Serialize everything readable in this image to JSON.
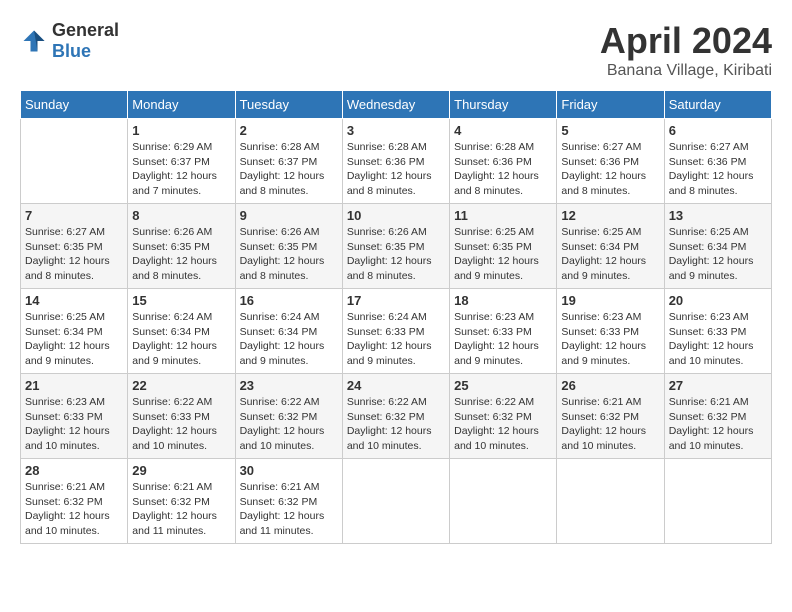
{
  "header": {
    "logo_general": "General",
    "logo_blue": "Blue",
    "month_year": "April 2024",
    "location": "Banana Village, Kiribati"
  },
  "weekdays": [
    "Sunday",
    "Monday",
    "Tuesday",
    "Wednesday",
    "Thursday",
    "Friday",
    "Saturday"
  ],
  "weeks": [
    [
      {
        "day": "",
        "info": ""
      },
      {
        "day": "1",
        "info": "Sunrise: 6:29 AM\nSunset: 6:37 PM\nDaylight: 12 hours\nand 7 minutes."
      },
      {
        "day": "2",
        "info": "Sunrise: 6:28 AM\nSunset: 6:37 PM\nDaylight: 12 hours\nand 8 minutes."
      },
      {
        "day": "3",
        "info": "Sunrise: 6:28 AM\nSunset: 6:36 PM\nDaylight: 12 hours\nand 8 minutes."
      },
      {
        "day": "4",
        "info": "Sunrise: 6:28 AM\nSunset: 6:36 PM\nDaylight: 12 hours\nand 8 minutes."
      },
      {
        "day": "5",
        "info": "Sunrise: 6:27 AM\nSunset: 6:36 PM\nDaylight: 12 hours\nand 8 minutes."
      },
      {
        "day": "6",
        "info": "Sunrise: 6:27 AM\nSunset: 6:36 PM\nDaylight: 12 hours\nand 8 minutes."
      }
    ],
    [
      {
        "day": "7",
        "info": "Sunrise: 6:27 AM\nSunset: 6:35 PM\nDaylight: 12 hours\nand 8 minutes."
      },
      {
        "day": "8",
        "info": "Sunrise: 6:26 AM\nSunset: 6:35 PM\nDaylight: 12 hours\nand 8 minutes."
      },
      {
        "day": "9",
        "info": "Sunrise: 6:26 AM\nSunset: 6:35 PM\nDaylight: 12 hours\nand 8 minutes."
      },
      {
        "day": "10",
        "info": "Sunrise: 6:26 AM\nSunset: 6:35 PM\nDaylight: 12 hours\nand 8 minutes."
      },
      {
        "day": "11",
        "info": "Sunrise: 6:25 AM\nSunset: 6:35 PM\nDaylight: 12 hours\nand 9 minutes."
      },
      {
        "day": "12",
        "info": "Sunrise: 6:25 AM\nSunset: 6:34 PM\nDaylight: 12 hours\nand 9 minutes."
      },
      {
        "day": "13",
        "info": "Sunrise: 6:25 AM\nSunset: 6:34 PM\nDaylight: 12 hours\nand 9 minutes."
      }
    ],
    [
      {
        "day": "14",
        "info": "Sunrise: 6:25 AM\nSunset: 6:34 PM\nDaylight: 12 hours\nand 9 minutes."
      },
      {
        "day": "15",
        "info": "Sunrise: 6:24 AM\nSunset: 6:34 PM\nDaylight: 12 hours\nand 9 minutes."
      },
      {
        "day": "16",
        "info": "Sunrise: 6:24 AM\nSunset: 6:34 PM\nDaylight: 12 hours\nand 9 minutes."
      },
      {
        "day": "17",
        "info": "Sunrise: 6:24 AM\nSunset: 6:33 PM\nDaylight: 12 hours\nand 9 minutes."
      },
      {
        "day": "18",
        "info": "Sunrise: 6:23 AM\nSunset: 6:33 PM\nDaylight: 12 hours\nand 9 minutes."
      },
      {
        "day": "19",
        "info": "Sunrise: 6:23 AM\nSunset: 6:33 PM\nDaylight: 12 hours\nand 9 minutes."
      },
      {
        "day": "20",
        "info": "Sunrise: 6:23 AM\nSunset: 6:33 PM\nDaylight: 12 hours\nand 10 minutes."
      }
    ],
    [
      {
        "day": "21",
        "info": "Sunrise: 6:23 AM\nSunset: 6:33 PM\nDaylight: 12 hours\nand 10 minutes."
      },
      {
        "day": "22",
        "info": "Sunrise: 6:22 AM\nSunset: 6:33 PM\nDaylight: 12 hours\nand 10 minutes."
      },
      {
        "day": "23",
        "info": "Sunrise: 6:22 AM\nSunset: 6:32 PM\nDaylight: 12 hours\nand 10 minutes."
      },
      {
        "day": "24",
        "info": "Sunrise: 6:22 AM\nSunset: 6:32 PM\nDaylight: 12 hours\nand 10 minutes."
      },
      {
        "day": "25",
        "info": "Sunrise: 6:22 AM\nSunset: 6:32 PM\nDaylight: 12 hours\nand 10 minutes."
      },
      {
        "day": "26",
        "info": "Sunrise: 6:21 AM\nSunset: 6:32 PM\nDaylight: 12 hours\nand 10 minutes."
      },
      {
        "day": "27",
        "info": "Sunrise: 6:21 AM\nSunset: 6:32 PM\nDaylight: 12 hours\nand 10 minutes."
      }
    ],
    [
      {
        "day": "28",
        "info": "Sunrise: 6:21 AM\nSunset: 6:32 PM\nDaylight: 12 hours\nand 10 minutes."
      },
      {
        "day": "29",
        "info": "Sunrise: 6:21 AM\nSunset: 6:32 PM\nDaylight: 12 hours\nand 11 minutes."
      },
      {
        "day": "30",
        "info": "Sunrise: 6:21 AM\nSunset: 6:32 PM\nDaylight: 12 hours\nand 11 minutes."
      },
      {
        "day": "",
        "info": ""
      },
      {
        "day": "",
        "info": ""
      },
      {
        "day": "",
        "info": ""
      },
      {
        "day": "",
        "info": ""
      }
    ]
  ]
}
